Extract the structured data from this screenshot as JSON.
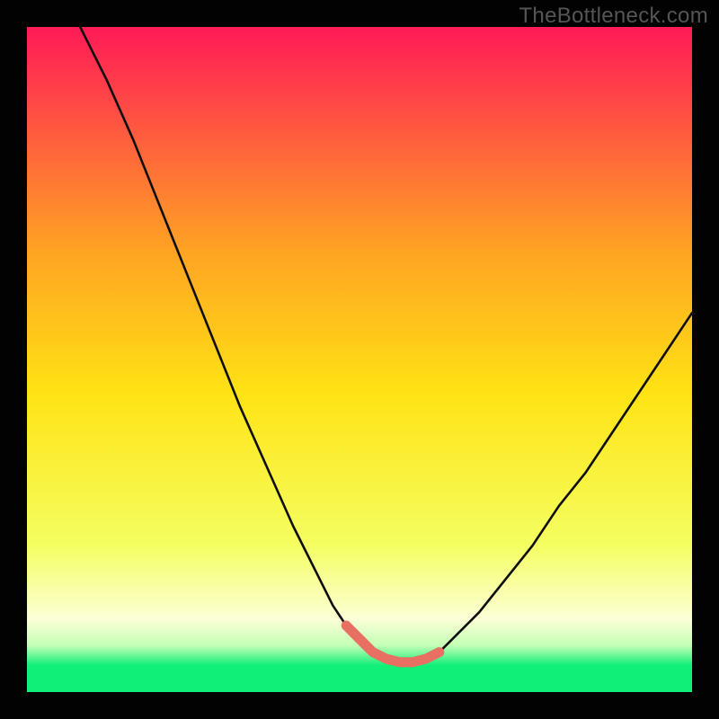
{
  "watermark": "TheBottleneck.com",
  "colors": {
    "gradient_top": "#ff1a56",
    "gradient_mid_upper": "#ff7d2b",
    "gradient_mid": "#ffe314",
    "gradient_mid_lower": "#f4ff62",
    "gradient_pale": "#fcffd6",
    "gradient_green": "#10ef77",
    "curve": "#0f0f0f",
    "bottom_segment": "#e87063",
    "frame": "#020202"
  },
  "chart_data": {
    "type": "line",
    "title": "",
    "xlabel": "",
    "ylabel": "",
    "xlim": [
      0,
      100
    ],
    "ylim": [
      0,
      100
    ],
    "grid": false,
    "legend": false,
    "annotations": [],
    "series": [
      {
        "name": "bottleneck-curve",
        "x": [
          8,
          12,
          16,
          20,
          24,
          28,
          32,
          36,
          40,
          44,
          46,
          48,
          50,
          52,
          54,
          56,
          58,
          60,
          62,
          64,
          68,
          72,
          76,
          80,
          84,
          88,
          92,
          96,
          100
        ],
        "y": [
          100,
          92,
          83,
          73,
          63,
          53,
          43,
          34,
          25,
          17,
          13,
          10,
          8,
          6,
          5,
          4.5,
          4.5,
          5,
          6,
          8,
          12,
          17,
          22,
          28,
          33,
          39,
          45,
          51,
          57
        ]
      }
    ],
    "highlight_segment": {
      "name": "low-bottleneck-zone",
      "x": [
        48,
        50,
        52,
        54,
        56,
        58,
        60,
        62
      ],
      "y": [
        10,
        8,
        6,
        5,
        4.5,
        4.5,
        5,
        6
      ]
    },
    "gradient_stops_pct": [
      {
        "offset": 0,
        "color": "#ff1a56"
      },
      {
        "offset": 34,
        "color": "#ffa423"
      },
      {
        "offset": 55,
        "color": "#ffe314"
      },
      {
        "offset": 78,
        "color": "#f4ff62"
      },
      {
        "offset": 89,
        "color": "#fcffd6"
      },
      {
        "offset": 93,
        "color": "#c4ffb6"
      },
      {
        "offset": 96,
        "color": "#10ef77"
      },
      {
        "offset": 100,
        "color": "#10ef77"
      }
    ]
  }
}
